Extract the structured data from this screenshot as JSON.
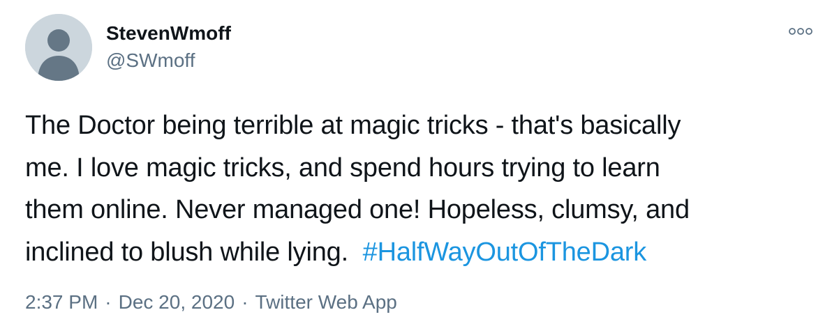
{
  "author": {
    "display_name": "StevenWmoff",
    "handle": "@SWmoff",
    "avatar_icon": "default-profile-avatar-icon"
  },
  "more_icon": "more-options-icon",
  "tweet": {
    "lines": [
      "The Doctor being terrible at magic tricks - that's basically",
      "me. I love magic tricks, and spend hours trying to learn",
      "them online. Never managed one! Hopeless, clumsy, and",
      "inclined to blush while lying."
    ],
    "hashtag": "#HalfWayOutOfTheDark"
  },
  "meta": {
    "time": "2:37 PM",
    "date": "Dec 20, 2020",
    "separator": "·",
    "source": "Twitter Web App"
  },
  "colors": {
    "text": "#0f1419",
    "secondary": "#5b7083",
    "link": "#1b95e0",
    "avatar_bg": "#ccd6dd",
    "avatar_fg": "#657786"
  }
}
